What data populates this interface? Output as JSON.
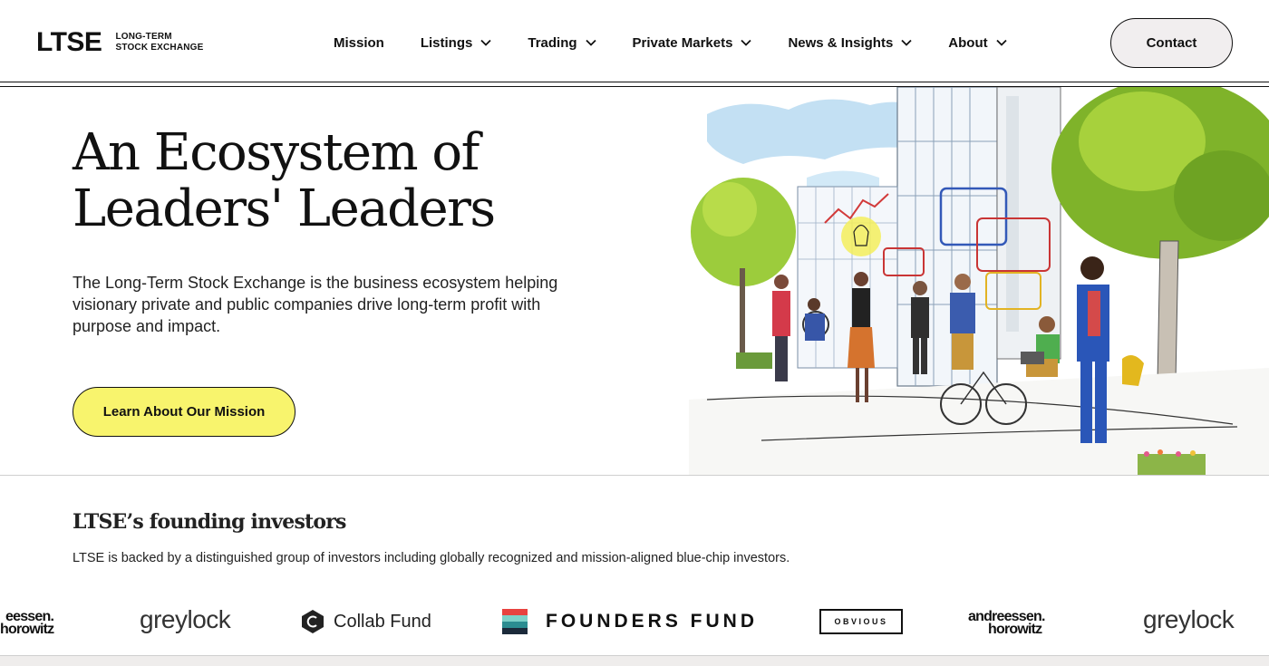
{
  "brand": {
    "mark": "LTSE",
    "sub_line1": "LONG-TERM",
    "sub_line2": "STOCK EXCHANGE"
  },
  "nav": {
    "items": [
      {
        "label": "Mission",
        "has_dropdown": false
      },
      {
        "label": "Listings",
        "has_dropdown": true
      },
      {
        "label": "Trading",
        "has_dropdown": true
      },
      {
        "label": "Private Markets",
        "has_dropdown": true
      },
      {
        "label": "News & Insights",
        "has_dropdown": true
      },
      {
        "label": "About",
        "has_dropdown": true
      }
    ],
    "contact_label": "Contact"
  },
  "hero": {
    "title_line1": "An Ecosystem of",
    "title_line2": "Leaders' Leaders",
    "description": "The Long-Term Stock Exchange is the business ecosystem helping visionary private and public companies drive long-term profit with purpose and impact.",
    "cta_label": "Learn About Our Mission"
  },
  "investors": {
    "title": "LTSE’s founding investors",
    "description": "LTSE is backed by a distinguished group of investors including globally recognized and mission-aligned blue-chip investors.",
    "logos": {
      "a16z_partial_line1": "eessen.",
      "a16z_partial_line2": "horowitz",
      "greylock": "greylock",
      "collab": "Collab Fund",
      "founders": "FOUNDERS FUND",
      "obvious": "OBVIOUS",
      "a16z_line1": "andreessen.",
      "a16z_line2": "horowitz",
      "greylock_2": "greylock"
    }
  },
  "colors": {
    "cta_yellow": "#f8f46d",
    "contact_bg": "#f1eeef",
    "text": "#111111"
  }
}
